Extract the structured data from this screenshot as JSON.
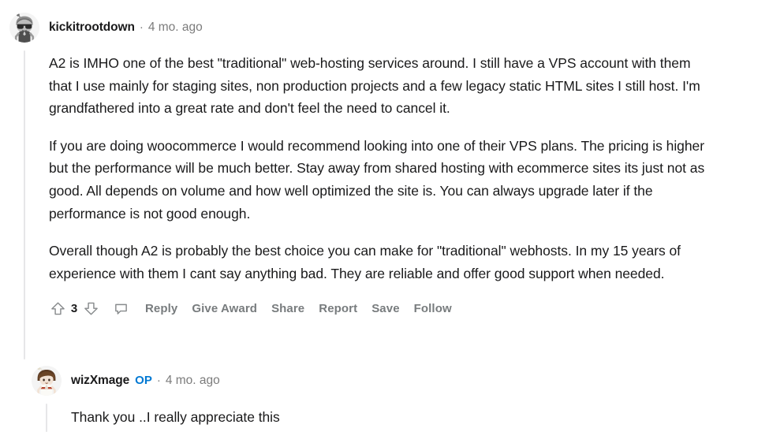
{
  "theme": {
    "background": "#ffffff",
    "text_color": "#1a1a1b",
    "meta_color": "#7c7c7c",
    "action_color": "#787c7e",
    "op_badge_color": "#0079d3",
    "threadline_color": "#e6e6e8"
  },
  "comments": [
    {
      "author": "kickitrootdown",
      "op_badge": "",
      "separator": "·",
      "timestamp": "4 mo. ago",
      "avatar": "snoo-avatar-sunglasses",
      "paragraphs": [
        "A2 is IMHO one of the best \"traditional\" web-hosting services around. I still have a VPS account with them that I use mainly for staging sites, non production projects and a few legacy static HTML sites I still host. I'm grandfathered into a great rate and don't feel the need to cancel it.",
        "If you are doing woocommerce I would recommend looking into one of their VPS plans. The pricing is higher but the performance will be much better. Stay away from shared hosting with ecommerce sites its just not as good. All depends on volume and how well optimized the site is. You can always upgrade later if the performance is not good enough.",
        "Overall though A2 is probably the best choice you can make for \"traditional\" webhosts. In my 15 years of experience with them I cant say anything bad. They are reliable and offer good support when needed."
      ],
      "actions": {
        "upvote_icon": "upvote-arrow-icon",
        "score": "3",
        "downvote_icon": "downvote-arrow-icon",
        "comment_icon": "speech-bubble-icon",
        "links": [
          "Reply",
          "Give Award",
          "Share",
          "Report",
          "Save",
          "Follow"
        ]
      }
    },
    {
      "author": "wizXmage",
      "op_badge": "OP",
      "separator": "·",
      "timestamp": "4 mo. ago",
      "avatar": "snoo-avatar-brown-hair",
      "paragraphs": [
        "Thank you ..I really appreciate this"
      ],
      "actions": null
    }
  ]
}
